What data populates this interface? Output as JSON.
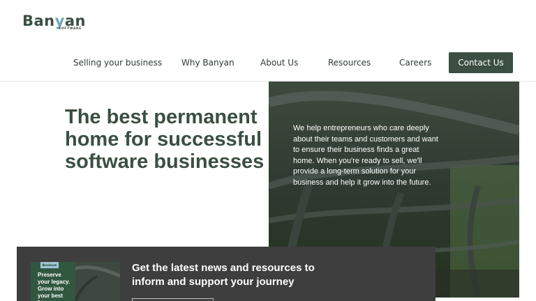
{
  "brand": {
    "name_pre": "Ban",
    "name_y": "y",
    "name_post": "an",
    "sub": "SOFTWARE"
  },
  "nav": {
    "items": [
      {
        "label": "Selling your business"
      },
      {
        "label": "Why Banyan"
      },
      {
        "label": "About Us"
      },
      {
        "label": "Resources"
      },
      {
        "label": "Careers"
      }
    ],
    "contact_label": "Contact Us"
  },
  "hero": {
    "title": "The best permanent home for successful software businesses",
    "body": "We help entrepreneurs who care deeply about their teams and customers and want to ensure their business finds a great home. When you're ready to sell, we'll provide a long-term solution for your business and help it grow into the future."
  },
  "newsletter": {
    "heading": "Get the latest news and resources to inform and support your journey",
    "thumb_badge": "Brochure",
    "thumb_title": "Preserve your legacy. Grow into your best future"
  },
  "colors": {
    "brand_green": "#3a4f42",
    "accent_blue": "#6fa5b8",
    "band_gray": "#3e3e3e"
  }
}
